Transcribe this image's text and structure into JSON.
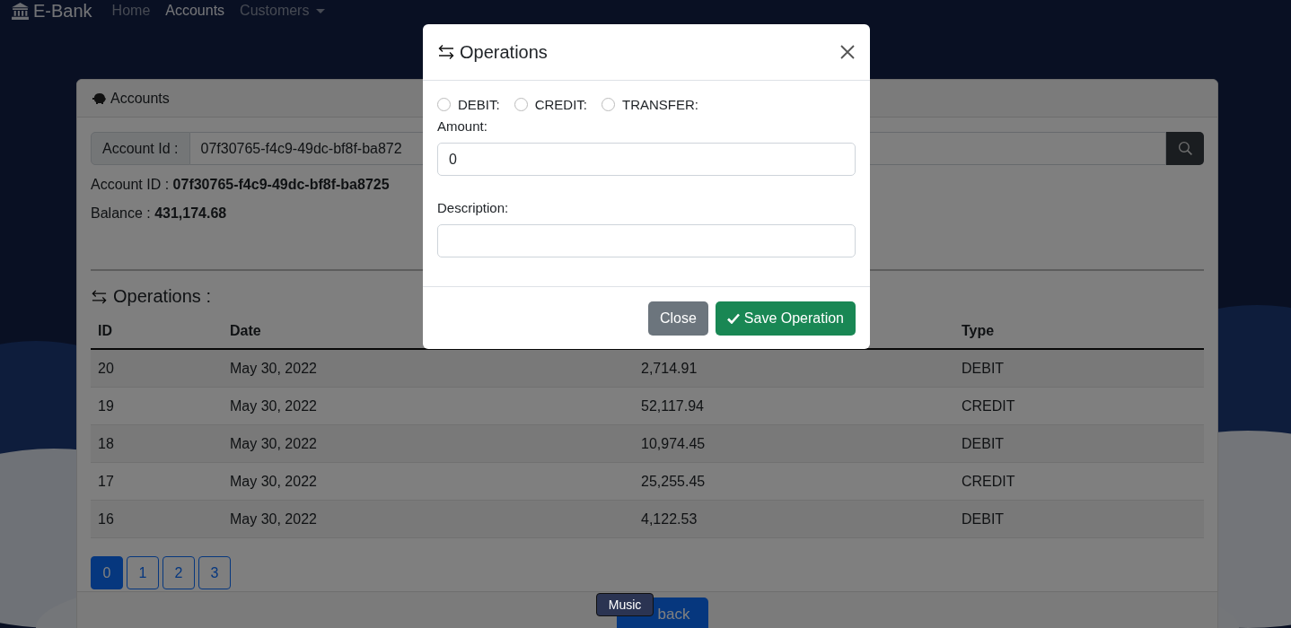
{
  "navbar": {
    "brand": "E-Bank",
    "items": [
      {
        "label": "Home",
        "selected": false,
        "dropdown": false
      },
      {
        "label": "Accounts",
        "selected": true,
        "dropdown": false
      },
      {
        "label": "Customers",
        "selected": false,
        "dropdown": true
      }
    ]
  },
  "card": {
    "title": "Accounts",
    "search": {
      "label": "Account Id :",
      "value": "07f30765-f4c9-49dc-bf8f-ba872"
    },
    "account_line": "Account ID : **07f30765-f4c9-49dc-bf8f-ba8725**",
    "balance_line": "Balance : **431,174.68**",
    "operations_title": "Operations :",
    "table": {
      "columns": [
        "ID",
        "Date",
        null,
        "Type"
      ],
      "rows": [
        {
          "id": "20",
          "date": "May 30, 2022",
          "amount": "2,714.91",
          "type": "DEBIT"
        },
        {
          "id": "19",
          "date": "May 30, 2022",
          "amount": "52,117.94",
          "type": "CREDIT"
        },
        {
          "id": "18",
          "date": "May 30, 2022",
          "amount": "10,974.45",
          "type": "DEBIT"
        },
        {
          "id": "17",
          "date": "May 30, 2022",
          "amount": "25,255.45",
          "type": "CREDIT"
        },
        {
          "id": "16",
          "date": "May 30, 2022",
          "amount": "4,122.53",
          "type": "DEBIT"
        }
      ]
    },
    "pages": [
      {
        "label": "0",
        "selected": true
      },
      {
        "label": "1",
        "selected": false
      },
      {
        "label": "2",
        "selected": false
      },
      {
        "label": "3",
        "selected": false
      }
    ],
    "back_button": "back"
  },
  "tooltip": "Music",
  "modal": {
    "title": "Operations",
    "types": [
      {
        "label": "DEBIT:",
        "selected": false
      },
      {
        "label": "CREDIT:",
        "selected": false
      },
      {
        "label": "TRANSFER:",
        "selected": false
      }
    ],
    "fields": [
      {
        "label": "Amount:",
        "value": "0"
      },
      {
        "label": "Description:"
      }
    ],
    "buttons": [
      {
        "kind": "secondary",
        "label": "Close"
      },
      {
        "kind": "primary",
        "label": "Save Operation"
      }
    ]
  }
}
